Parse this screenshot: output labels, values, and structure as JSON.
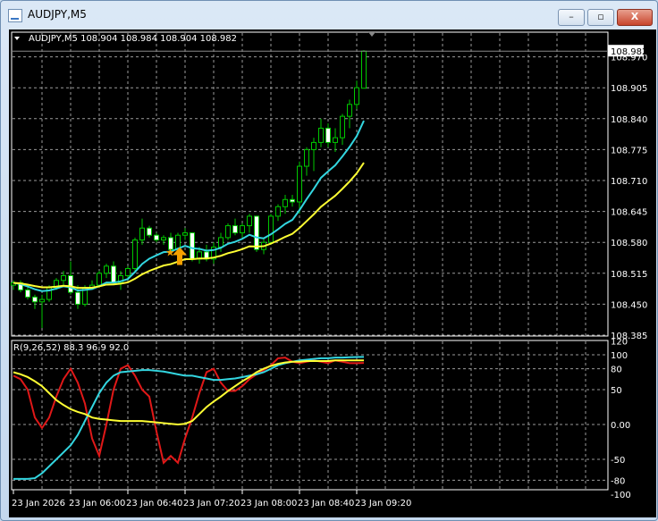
{
  "window": {
    "title": "AUDJPY,M5",
    "buttons": {
      "minimize": "–",
      "maximize": "▫",
      "close": "X"
    }
  },
  "colors": {
    "background": "#000000",
    "candle_outline": "#00c800",
    "bear_fill": "#ffffff",
    "ma_fast": "#33d6e0",
    "ma_slow": "#ffff33",
    "osc_red": "#e01818",
    "osc_cyan": "#33d6e0",
    "osc_yellow": "#ffff33",
    "arrow": "#f5a000",
    "grid": "#9a9a9a"
  },
  "main": {
    "header": "AUDJPY,M5  108.904 108.984 108.904 108.982",
    "price_badge": "108.982",
    "price_labels": [
      "108.970",
      "108.905",
      "108.840",
      "108.775",
      "108.710",
      "108.645",
      "108.580",
      "108.515",
      "108.450",
      "108.385"
    ]
  },
  "sub": {
    "header": "R(9,26,52) 88.3 96.9 92.0",
    "labels": [
      "120",
      "100",
      "80",
      "50",
      "0.00",
      "-50",
      "-80",
      "-100"
    ]
  },
  "time_labels": [
    "23 Jan 2026",
    "23 Jan 06:00",
    "23 Jan 06:40",
    "23 Jan 07:20",
    "23 Jan 08:00",
    "23 Jan 08:40",
    "23 Jan 09:20"
  ],
  "chart_data": [
    {
      "type": "candlestick",
      "symbol": "AUDJPY",
      "timeframe": "M5",
      "ylim": [
        108.385,
        108.99
      ],
      "signal": {
        "type": "buy-arrow",
        "candle_index": 24
      },
      "ohlc": [
        [
          108.49,
          108.5,
          108.48,
          108.495
        ],
        [
          108.495,
          108.5,
          108.475,
          108.48
        ],
        [
          108.48,
          108.49,
          108.46,
          108.465
        ],
        [
          108.465,
          108.47,
          108.44,
          108.455
        ],
        [
          108.455,
          108.47,
          108.4,
          108.46
        ],
        [
          108.46,
          108.49,
          108.455,
          108.485
        ],
        [
          108.485,
          108.505,
          108.48,
          108.5
        ],
        [
          108.5,
          108.52,
          108.49,
          108.51
        ],
        [
          108.51,
          108.54,
          108.47,
          108.475
        ],
        [
          108.475,
          108.49,
          108.44,
          108.45
        ],
        [
          108.45,
          108.49,
          108.445,
          108.485
        ],
        [
          108.485,
          108.5,
          108.48,
          108.49
        ],
        [
          108.49,
          108.52,
          108.485,
          108.515
        ],
        [
          108.515,
          108.535,
          108.505,
          108.53
        ],
        [
          108.53,
          108.54,
          108.49,
          108.495
        ],
        [
          108.495,
          108.52,
          108.48,
          108.51
        ],
        [
          108.51,
          108.53,
          108.5,
          108.525
        ],
        [
          108.525,
          108.59,
          108.52,
          108.585
        ],
        [
          108.585,
          108.63,
          108.575,
          108.61
        ],
        [
          108.61,
          108.615,
          108.59,
          108.595
        ],
        [
          108.595,
          108.6,
          108.58,
          108.585
        ],
        [
          108.585,
          108.595,
          108.575,
          108.59
        ],
        [
          108.59,
          108.6,
          108.56,
          108.565
        ],
        [
          108.565,
          108.6,
          108.56,
          108.595
        ],
        [
          108.595,
          108.61,
          108.585,
          108.6
        ],
        [
          108.6,
          108.6,
          108.54,
          108.545
        ],
        [
          108.545,
          108.57,
          108.535,
          108.56
        ],
        [
          108.56,
          108.575,
          108.54,
          108.545
        ],
        [
          108.545,
          108.58,
          108.535,
          108.57
        ],
        [
          108.57,
          108.6,
          108.56,
          108.59
        ],
        [
          108.59,
          108.62,
          108.585,
          108.615
        ],
        [
          108.615,
          108.63,
          108.595,
          108.6
        ],
        [
          108.6,
          108.62,
          108.59,
          108.615
        ],
        [
          108.615,
          108.64,
          108.6,
          108.635
        ],
        [
          108.635,
          108.635,
          108.56,
          108.565
        ],
        [
          108.565,
          108.59,
          108.555,
          108.58
        ],
        [
          108.58,
          108.64,
          108.575,
          108.635
        ],
        [
          108.635,
          108.66,
          108.625,
          108.655
        ],
        [
          108.655,
          108.68,
          108.64,
          108.67
        ],
        [
          108.67,
          108.68,
          108.655,
          108.665
        ],
        [
          108.665,
          108.75,
          108.64,
          108.74
        ],
        [
          108.74,
          108.78,
          108.72,
          108.775
        ],
        [
          108.775,
          108.8,
          108.73,
          108.79
        ],
        [
          108.79,
          108.84,
          108.78,
          108.82
        ],
        [
          108.82,
          108.83,
          108.78,
          108.79
        ],
        [
          108.79,
          108.82,
          108.77,
          108.8
        ],
        [
          108.8,
          108.85,
          108.785,
          108.845
        ],
        [
          108.845,
          108.88,
          108.82,
          108.87
        ],
        [
          108.87,
          108.92,
          108.86,
          108.905
        ],
        [
          108.904,
          108.984,
          108.904,
          108.982
        ]
      ]
    },
    {
      "type": "line",
      "ylim": [
        -100,
        120
      ],
      "series": [
        {
          "color": "#e01818",
          "values": [
            70,
            65,
            50,
            10,
            -5,
            10,
            40,
            65,
            80,
            60,
            30,
            -20,
            -45,
            0,
            50,
            80,
            85,
            70,
            50,
            40,
            -10,
            -55,
            -45,
            -55,
            -20,
            10,
            45,
            75,
            80,
            60,
            48,
            48,
            55,
            65,
            72,
            78,
            85,
            95,
            96,
            90,
            88,
            90,
            92,
            90,
            88,
            92,
            90,
            88,
            88,
            88.3
          ]
        },
        {
          "color": "#33d6e0",
          "values": [
            -78,
            -78,
            -78,
            -77,
            -70,
            -60,
            -50,
            -40,
            -30,
            -15,
            5,
            25,
            45,
            60,
            70,
            75,
            76,
            77,
            78,
            78,
            77,
            76,
            74,
            72,
            70,
            70,
            68,
            66,
            64,
            64,
            65,
            66,
            68,
            70,
            72,
            75,
            80,
            85,
            88,
            90,
            92,
            93,
            94,
            95,
            95,
            96,
            96,
            96.5,
            96.8,
            96.9
          ]
        },
        {
          "color": "#ffff33",
          "values": [
            75,
            72,
            68,
            62,
            55,
            45,
            35,
            28,
            22,
            18,
            15,
            10,
            8,
            7,
            6,
            5,
            5,
            5,
            5,
            4,
            3,
            2,
            1,
            0,
            1,
            5,
            15,
            25,
            33,
            40,
            48,
            55,
            62,
            68,
            75,
            80,
            84,
            87,
            89,
            90,
            90,
            91,
            91,
            91,
            91,
            92,
            92,
            92,
            92,
            92
          ]
        }
      ]
    }
  ]
}
